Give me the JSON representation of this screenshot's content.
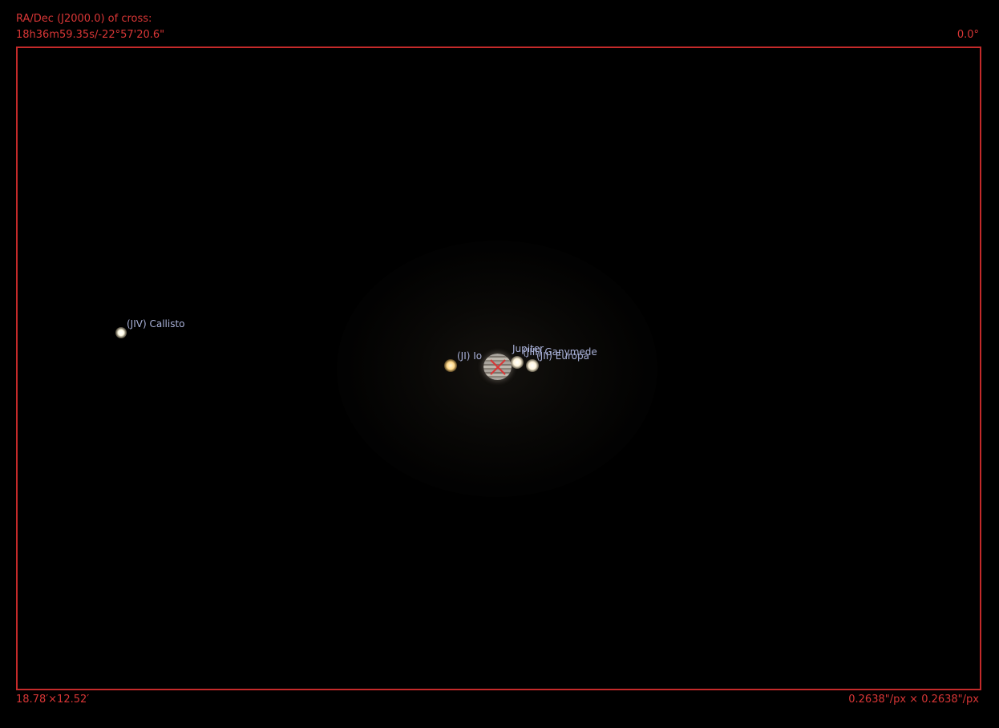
{
  "ocular_info": {
    "ra_dec_label": "RA/Dec (J2000.0) of cross:",
    "ra_dec_value": "18h36m59.35s/-22°57'20.6\"",
    "rotation": "0.0°",
    "field_of_view": "18.78′×12.52′",
    "image_scale": "0.2638\"/px × 0.2638\"/px"
  },
  "objects": {
    "callisto": "(JIV) Callisto",
    "io": "(JI) Io",
    "jupiter": "Jupiter",
    "ganymede": "(JIII) Ganymede",
    "europa": "(JII) Europa"
  },
  "colors": {
    "ocular_red": "#d93636",
    "frame_red": "#c42a2a",
    "label_blue": "#a9b1d8",
    "background": "#000000"
  },
  "icons": {
    "crosshair": "cross-marker-icon"
  }
}
